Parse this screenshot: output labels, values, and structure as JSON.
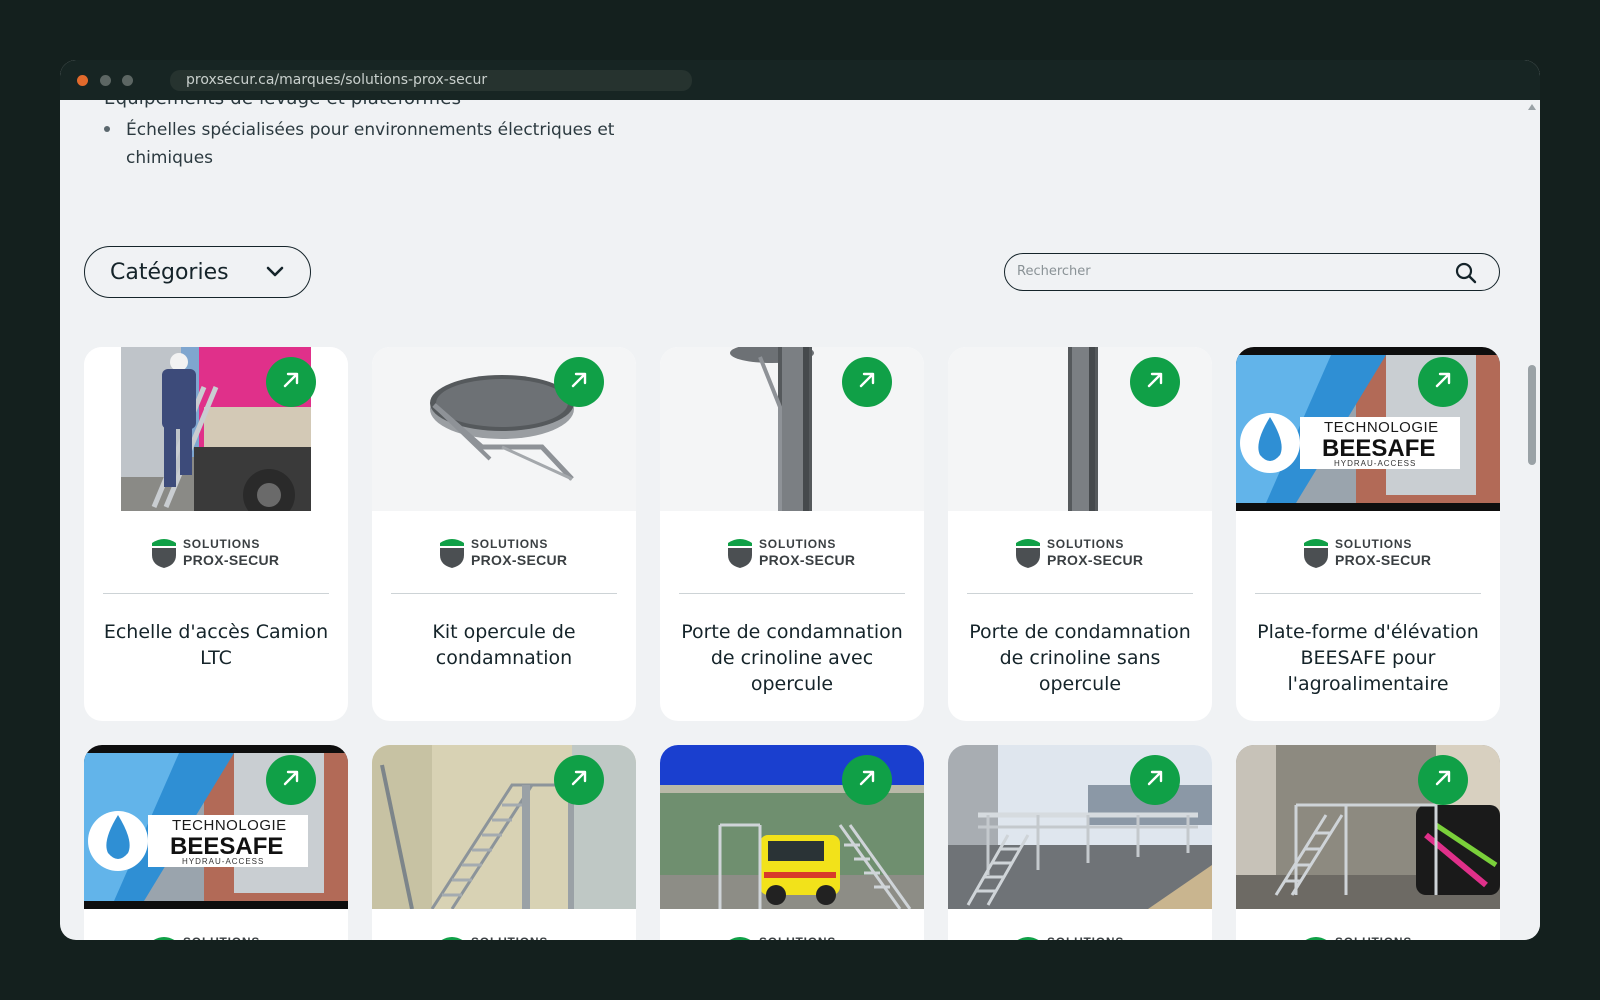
{
  "browser": {
    "url": "proxsecur.ca/marques/solutions-prox-secur"
  },
  "intro": {
    "partial_line": "Équipements de levage et plateformes",
    "bullets": [
      "Échelles spécialisées pour environnements électriques et chimiques"
    ]
  },
  "filters": {
    "categories_label": "Catégories",
    "search_placeholder": "Rechercher"
  },
  "brand": {
    "line1": "SOLUTIONS",
    "line2": "PROX-SECUR",
    "accent_color": "#10a047"
  },
  "products": [
    {
      "title": "Echelle d'accès Camion LTC",
      "image": "photo-truck-ladder",
      "brand": "SOLUTIONS PROX-SECUR"
    },
    {
      "title": "Kit opercule de condamnation",
      "image": "render-round-hatch",
      "brand": "SOLUTIONS PROX-SECUR"
    },
    {
      "title": "Porte de condamnation de crinoline avec opercule",
      "image": "render-door-with-hatch",
      "brand": "SOLUTIONS PROX-SECUR"
    },
    {
      "title": "Porte de condamnation de crinoline sans opercule",
      "image": "render-door-without-hatch",
      "brand": "SOLUTIONS PROX-SECUR"
    },
    {
      "title": "Plate-forme d'élévation BEESAFE pour l'agroalimentaire",
      "image": "beesafe-video-thumbnail",
      "brand": "SOLUTIONS PROX-SECUR"
    },
    {
      "title": "",
      "image": "beesafe-video-thumbnail",
      "brand": "SOLUTIONS PROX-SECUR"
    },
    {
      "title": "",
      "image": "photo-industrial-stairs",
      "brand": "SOLUTIONS PROX-SECUR"
    },
    {
      "title": "",
      "image": "photo-van-maintenance-platform",
      "brand": "SOLUTIONS PROX-SECUR"
    },
    {
      "title": "",
      "image": "photo-long-walkway-platform",
      "brand": "SOLUTIONS PROX-SECUR"
    },
    {
      "title": "",
      "image": "photo-bus-maintenance-platform",
      "brand": "SOLUTIONS PROX-SECUR"
    }
  ],
  "beesafe": {
    "line1": "TECHNOLOGIE",
    "line2": "BEESAFE",
    "line3": "HYDRAU-ACCESS"
  }
}
